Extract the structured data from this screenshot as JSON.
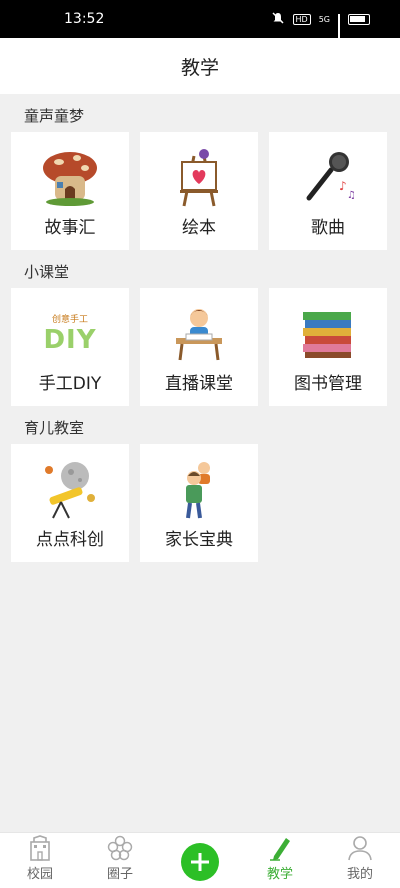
{
  "status_bar": {
    "time": "13:52",
    "network": "5G",
    "hd": "HD"
  },
  "header": {
    "title": "教学"
  },
  "sections": [
    {
      "title": "童声童梦",
      "items": [
        {
          "label": "故事汇",
          "icon": "mushroom-house-icon"
        },
        {
          "label": "绘本",
          "icon": "easel-icon"
        },
        {
          "label": "歌曲",
          "icon": "microphone-icon"
        }
      ]
    },
    {
      "title": "小课堂",
      "items": [
        {
          "label": "手工DIY",
          "icon": "diy-craft-icon",
          "badge": "创意手工",
          "badge_text": "DIY"
        },
        {
          "label": "直播课堂",
          "icon": "student-desk-icon"
        },
        {
          "label": "图书管理",
          "icon": "book-stack-icon"
        }
      ]
    },
    {
      "title": "育儿教室",
      "items": [
        {
          "label": "点点科创",
          "icon": "telescope-moon-icon"
        },
        {
          "label": "家长宝典",
          "icon": "parent-child-icon"
        }
      ]
    }
  ],
  "tab_bar": {
    "items": [
      {
        "label": "校园",
        "icon": "school-building-icon",
        "active": false
      },
      {
        "label": "圈子",
        "icon": "flower-icon",
        "active": false
      },
      {
        "label": "",
        "icon": "plus-icon",
        "active": false
      },
      {
        "label": "教学",
        "icon": "pen-icon",
        "active": true
      },
      {
        "label": "我的",
        "icon": "person-icon",
        "active": false
      }
    ]
  },
  "colors": {
    "accent": "#3cae35",
    "plus": "#2cbf26",
    "background": "#f0f0f0"
  }
}
